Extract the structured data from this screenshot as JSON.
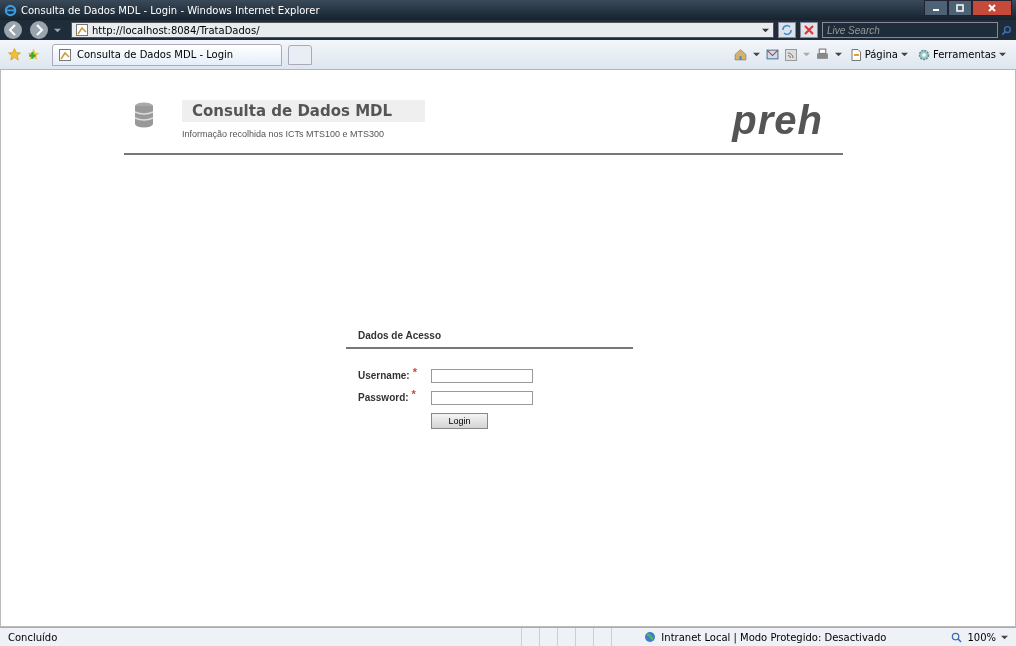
{
  "window": {
    "title": "Consulta de Dados MDL - Login - Windows Internet Explorer"
  },
  "address_bar": {
    "url": "http://localhost:8084/TrataDados/",
    "search_placeholder": "Live Search"
  },
  "tabs": [
    {
      "label": "Consulta de Dados MDL - Login",
      "selected": true
    }
  ],
  "command_bar": [
    {
      "label": "Página"
    },
    {
      "label": "Ferramentas"
    }
  ],
  "header": {
    "title": "Consulta de Dados MDL",
    "subtitle": "Informação recolhida nos ICTs MTS100 e MTS300",
    "logo": "preh"
  },
  "login": {
    "heading": "Dados de Acesso",
    "fields": [
      {
        "label": "Username:",
        "required_mark": "*"
      },
      {
        "label": "Password:",
        "required_mark": "*"
      }
    ],
    "button": "Login"
  },
  "status_bar": {
    "status": "Concluído",
    "zone": "Intranet Local | Modo Protegido: Desactivado",
    "zoom": "100%"
  }
}
